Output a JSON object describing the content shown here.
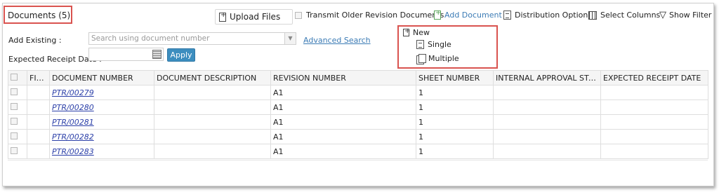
{
  "header": {
    "title": "Documents (5)"
  },
  "toolbar": {
    "upload_label": "Upload Files",
    "transmit_label": "Transmit Older Revision Documents",
    "add_document_label": "Add Document",
    "distribution_label": "Distribution Option",
    "select_columns_label": "Select Columns",
    "show_filter_label": "Show Filter"
  },
  "filters": {
    "add_existing_label": "Add Existing :",
    "search_placeholder": "Search using document number",
    "advanced_search_label": "Advanced Search",
    "expected_receipt_label": "Expected Receipt Date :",
    "apply_label": "Apply"
  },
  "add_menu": {
    "new_label": "New",
    "single_label": "Single",
    "multiple_label": "Multiple"
  },
  "table": {
    "columns": [
      "",
      "FILE...",
      "DOCUMENT NUMBER",
      "DOCUMENT DESCRIPTION",
      "REVISION NUMBER",
      "SHEET NUMBER",
      "INTERNAL APPROVAL STATU...",
      "EXPECTED RECEIPT DATE"
    ],
    "rows": [
      {
        "doc": "PTR/00279",
        "desc": "",
        "rev": "A1",
        "sheet": "1",
        "approval": "",
        "receipt": ""
      },
      {
        "doc": "PTR/00280",
        "desc": "",
        "rev": "A1",
        "sheet": "1",
        "approval": "",
        "receipt": ""
      },
      {
        "doc": "PTR/00281",
        "desc": "",
        "rev": "A1",
        "sheet": "1",
        "approval": "",
        "receipt": ""
      },
      {
        "doc": "PTR/00282",
        "desc": "",
        "rev": "A1",
        "sheet": "1",
        "approval": "",
        "receipt": ""
      },
      {
        "doc": "PTR/00283",
        "desc": "",
        "rev": "A1",
        "sheet": "1",
        "approval": "",
        "receipt": ""
      }
    ]
  },
  "colors": {
    "accent": "#3b7bb5",
    "highlight": "#d9534f",
    "apply_bg": "#3d8ebf",
    "link": "#2b3fa8"
  }
}
